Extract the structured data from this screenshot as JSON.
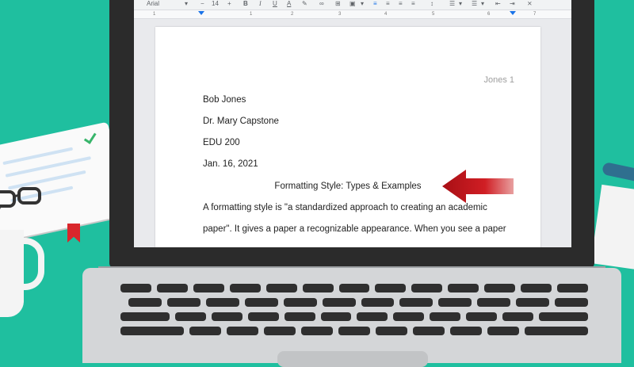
{
  "toolbar": {
    "font_name": "Arial",
    "font_size": "14",
    "icons": [
      "minus-icon",
      "plus-icon",
      "bold-icon",
      "italic-icon",
      "underline-icon",
      "text-color-icon",
      "highlight-icon",
      "link-icon",
      "comment-icon",
      "image-icon",
      "align-left-icon",
      "align-center-icon",
      "align-right-icon",
      "justify-icon",
      "line-spacing-icon",
      "checklist-icon",
      "bullet-list-icon",
      "decrease-indent-icon",
      "increase-indent-icon",
      "clear-format-icon"
    ],
    "accent": "#1a73e8"
  },
  "ruler": {
    "numbers": [
      "1",
      "1",
      "2",
      "3",
      "4",
      "5",
      "6",
      "7"
    ]
  },
  "document": {
    "header": "Jones 1",
    "lines": [
      "Bob Jones",
      "Dr. Mary Capstone",
      "EDU 200",
      "Jan. 16, 2021"
    ],
    "title": "Formatting Style: Types & Examples",
    "paragraph": [
      "A formatting style is \"a standardized approach to creating an academic",
      "paper\". It gives a paper a recognizable appearance. When you see a paper"
    ]
  },
  "colors": {
    "background": "#1fbf9f",
    "arrow": "#c8161d"
  }
}
